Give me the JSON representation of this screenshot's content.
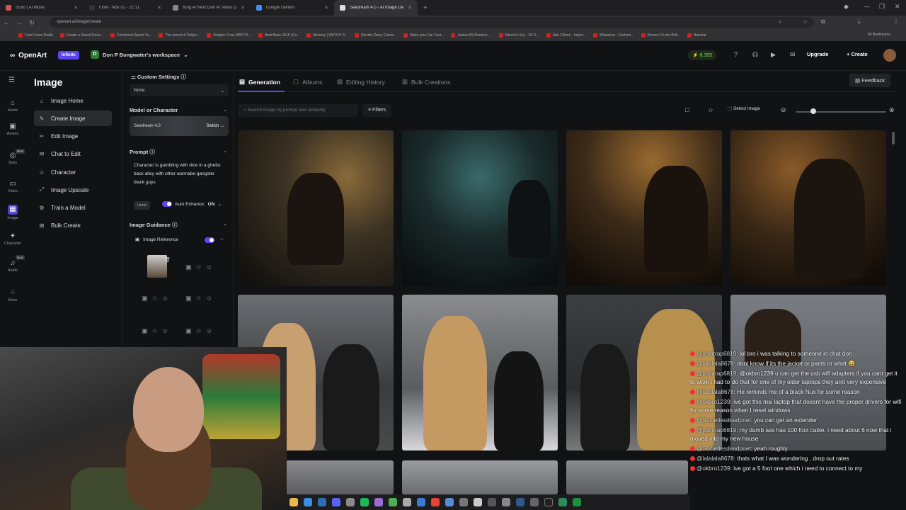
{
  "browser": {
    "tabs": [
      {
        "title": "Suno | AI Music"
      },
      {
        "title": "Flow - Nov 02 - 22:11"
      },
      {
        "title": "King At Next Gen AI Video G..."
      },
      {
        "title": "Google Gemini"
      },
      {
        "title": "Seedream 4.0 - AI Image Gene..."
      }
    ],
    "new_tab": "+",
    "url": "openart.ai/image/create",
    "bookmarks": [
      "Fast Forest Radio",
      "Create a Sound Reca...",
      "Combined Speed Te...",
      "The secret of Deltyo...",
      "Delgion Crew WATCH...",
      "Hard Bass 2015 (Ca...",
      "Memory | WATCH D...",
      "Electric Daisy Carniv...",
      "Make your Car Fast...",
      "Justice Bit Remixer ...",
      "Mixed in Key - DJ S...",
      "Star Citizen - Impro...",
      "Whatsbox - Fashion...",
      "Romeo 10 min Bolt...",
      "Barchat"
    ],
    "all_bookmarks": "All Bookmarks"
  },
  "header": {
    "logo": "OpenArt",
    "plan": "Infinite",
    "workspace_initial": "D",
    "workspace": "Don P Bongwater's workspace",
    "credits": "8,355",
    "upgrade": "Upgrade",
    "create": "+ Create"
  },
  "rail": [
    {
      "label": "Home",
      "icon": "⌂"
    },
    {
      "label": "Assets",
      "icon": "▣"
    },
    {
      "label": "Story",
      "icon": "◎",
      "badge": "Beta"
    },
    {
      "label": "Video",
      "icon": "▭"
    },
    {
      "label": "Image",
      "icon": "▦"
    },
    {
      "label": "Character",
      "icon": "✦"
    },
    {
      "label": "Audio",
      "icon": "♫",
      "badge": "New"
    },
    {
      "label": "More",
      "icon": "⁘"
    }
  ],
  "image_menu": {
    "title": "Image",
    "items": [
      {
        "label": "Image Home",
        "icon": "⌂"
      },
      {
        "label": "Create Image",
        "icon": "✎"
      },
      {
        "label": "Edit Image",
        "icon": "✂"
      },
      {
        "label": "Chat to Edit",
        "icon": "✉"
      },
      {
        "label": "Character",
        "icon": "☺"
      },
      {
        "label": "Image Upscale",
        "icon": "⤢"
      },
      {
        "label": "Train a Model",
        "icon": "⚙"
      },
      {
        "label": "Bulk Create",
        "icon": "⊞"
      }
    ]
  },
  "settings": {
    "custom_settings": "Custom Settings",
    "preset": "None",
    "model_section": "Model or Character",
    "model_name": "Seedream 4.0",
    "switch": "Switch",
    "prompt_section": "Prompt",
    "prompt_text": "Character is gambling with dice in a ghetto back alley with other wannabe gangster black guys",
    "undo": "Undo",
    "auto_enhance": "Auto Enhance:",
    "auto_enhance_value": "ON",
    "guidance_section": "Image Guidance",
    "image_reference": "Image Reference"
  },
  "main": {
    "tabs": [
      "Generation",
      "Albums",
      "Editing History",
      "Bulk Creations"
    ],
    "feedback": "Feedback",
    "search_placeholder": "Search image by prompt and similarity",
    "filters": "Filters",
    "select_image": "Select Image",
    "zoom_level": 0.2
  },
  "chat": [
    {
      "user": "@joshtrap6819",
      "text": "lol bro i was talking to someone in chat don"
    },
    {
      "user": "@lalalala8678",
      "text": "dont know if its the jacket or pants or what 😆"
    },
    {
      "user": "@joshtrap6819",
      "text": "@okbro1239 u can get the usb wifi adapters if you cant get it to work i had to do that for one of my older laptops they arnt very expensive"
    },
    {
      "user": "@lalalala8678",
      "text": "He reminds me of a black Nux for some reason"
    },
    {
      "user": "@okbro1239",
      "text": "ive got this msi laptop that doesnt have the proper drivers for wifi for some reason when I reset windows"
    },
    {
      "user": "@Societiesdeadpoet",
      "text": "you can get an extender"
    },
    {
      "user": "@joshtrap6819",
      "text": "my dumb ass has 100 foot cable. i need about 6 now that i moved into my new house"
    },
    {
      "user": "@Societiesdeadpoet",
      "text": "yeah roughly"
    },
    {
      "user": "@lalalala8678",
      "text": "thats what I was wondering , drop out rates"
    },
    {
      "user": "@okbro1239",
      "text": "ive got a 5 foot one which i need to connect to my"
    }
  ]
}
